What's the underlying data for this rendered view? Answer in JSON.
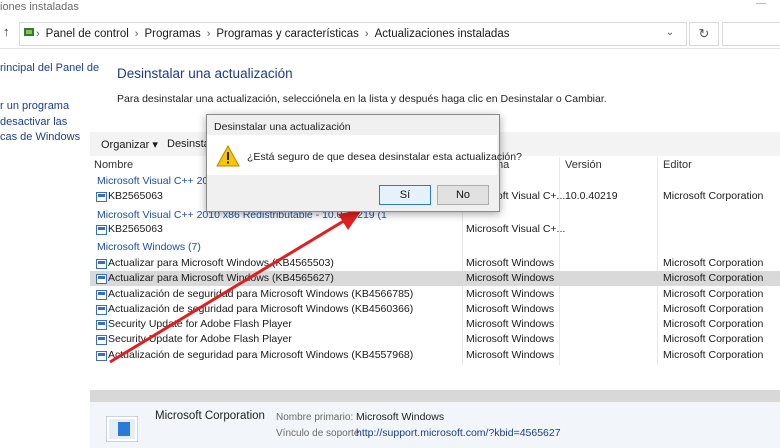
{
  "window": {
    "title_fragment": "iones instaladas",
    "controls": "—"
  },
  "address": {
    "crumbs": [
      "Panel de control",
      "Programas",
      "Programas y características",
      "Actualizaciones instaladas"
    ]
  },
  "left_pane": {
    "links": [
      "rincipal del Panel de",
      "r un programa",
      "desactivar las",
      "cas de Windows"
    ]
  },
  "page": {
    "title": "Desinstalar una actualización",
    "description": "Para desinstalar una actualización, selecciónela en la lista y después haga clic en Desinstalar o Cambiar."
  },
  "toolbar": {
    "organize": "Organizar ▾",
    "uninstall": "Desinsta"
  },
  "columns": {
    "name": "Nombre",
    "program": "ma",
    "version": "Versión",
    "publisher": "Editor"
  },
  "groups": [
    {
      "label": "Microsoft Visual C++ 2010"
    },
    {
      "label": "Microsoft Visual C++ 2010  x86 Redistributable - 10.0.40219 (1"
    },
    {
      "label": "Microsoft Windows (7)"
    }
  ],
  "rows": [
    {
      "name": "KB2565063",
      "program": "Microsoft Visual C+...",
      "version": "10.0.40219",
      "publisher": "Microsoft Corporation"
    },
    {
      "name": "KB2565063",
      "program": "Microsoft Visual C+...",
      "version": "",
      "publisher": ""
    },
    {
      "name": "Actualizar para Microsoft Windows (KB4565503)",
      "program": "Microsoft Windows",
      "version": "",
      "publisher": "Microsoft Corporation"
    },
    {
      "name": "Actualizar para Microsoft Windows (KB4565627)",
      "program": "Microsoft Windows",
      "version": "",
      "publisher": "Microsoft Corporation"
    },
    {
      "name": "Actualización de seguridad para Microsoft Windows (KB4566785)",
      "program": "Microsoft Windows",
      "version": "",
      "publisher": "Microsoft Corporation"
    },
    {
      "name": "Actualización de seguridad para Microsoft Windows (KB4560366)",
      "program": "Microsoft Windows",
      "version": "",
      "publisher": "Microsoft Corporation"
    },
    {
      "name": "Security Update for Adobe Flash Player",
      "program": "Microsoft Windows",
      "version": "",
      "publisher": "Microsoft Corporation"
    },
    {
      "name": "Security Update for Adobe Flash Player",
      "program": "Microsoft Windows",
      "version": "",
      "publisher": "Microsoft Corporation"
    },
    {
      "name": "Actualización de seguridad para Microsoft Windows (KB4557968)",
      "program": "Microsoft Windows",
      "version": "",
      "publisher": "Microsoft Corporation"
    }
  ],
  "details": {
    "company": "Microsoft Corporation",
    "primary_label": "Nombre primario:",
    "primary_value": "Microsoft Windows",
    "support_label": "Vínculo de soporte ...",
    "support_value": "http://support.microsoft.com/?kbid=4565627"
  },
  "dialog": {
    "title": "Desinstalar una actualización",
    "message": "¿Está seguro de que desea desinstalar esta actualización?",
    "yes": "Sí",
    "no": "No",
    "icon": "warning-icon"
  },
  "colors": {
    "accent": "#1e3a8a",
    "arrow": "#e02020",
    "selection": "#d9d9d9"
  },
  "icons": [
    "up-arrow-icon",
    "control-panel-icon",
    "refresh-icon",
    "update-icon",
    "warning-icon",
    "windows-update-icon"
  ]
}
